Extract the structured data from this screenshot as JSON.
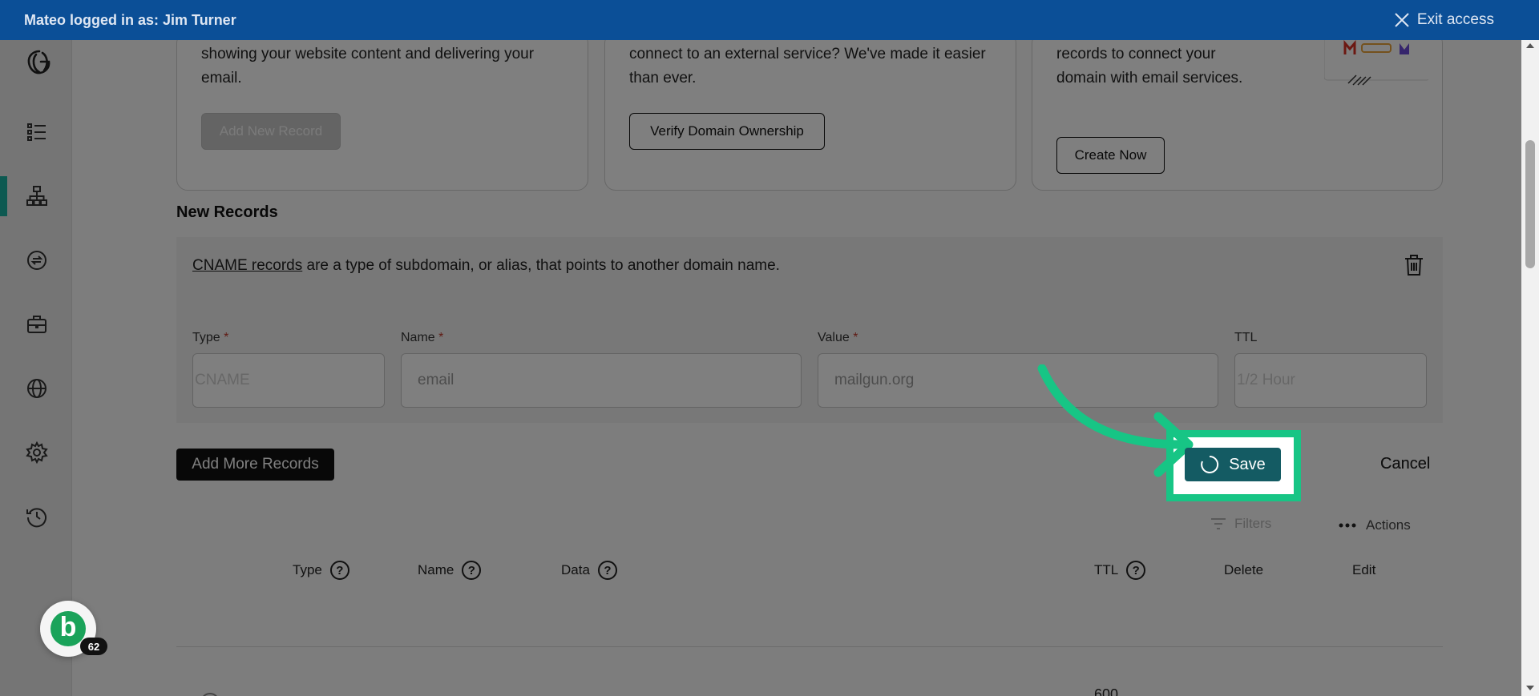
{
  "banner": {
    "logged_in_text": "Mateo logged in as: Jim Turner",
    "exit_label": "Exit access"
  },
  "cards": [
    {
      "text": "showing your website content and delivering your email.",
      "button": "Add New Record"
    },
    {
      "text": "connect to an external service? We've made it easier than ever.",
      "button": "Verify Domain Ownership"
    },
    {
      "text": "records to connect your domain with email services.",
      "button": "Create Now"
    }
  ],
  "new_records": {
    "title": "New Records",
    "link_text": "CNAME records",
    "description": " are a type of subdomain, or alias, that points to another domain name.",
    "fields": {
      "type_label": "Type",
      "type_value": "CNAME",
      "name_label": "Name",
      "name_value": "email",
      "value_label": "Value",
      "value_value": "mailgun.org",
      "ttl_label": "TTL",
      "ttl_value": "1/2 Hour",
      "required_mark": "*"
    },
    "add_more_label": "Add More Records",
    "save_label": "Save",
    "cancel_label": "Cancel"
  },
  "toolbar": {
    "filters_label": "Filters",
    "actions_label": "Actions"
  },
  "table": {
    "columns": {
      "type": "Type",
      "name": "Name",
      "data": "Data",
      "ttl": "TTL",
      "delete": "Delete",
      "edit": "Edit"
    },
    "help_glyph": "?",
    "first_row_ttl": "600"
  },
  "chat_bubble": {
    "letter": "b",
    "badge_count": "62"
  },
  "colors": {
    "banner": "#0b4f97",
    "accent_teal": "#145b63",
    "highlight_green": "#17c585",
    "nav_active": "#1bb3a3"
  }
}
